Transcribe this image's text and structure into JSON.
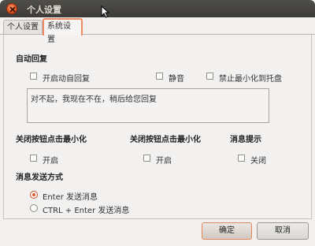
{
  "window": {
    "title": "个人设置"
  },
  "tabs": [
    {
      "label": "个人设置",
      "active": false
    },
    {
      "label": "系统设置",
      "active": true
    }
  ],
  "auto_reply": {
    "heading": "自动回复",
    "enable_label": "开启动自回复",
    "mute_label": "静音",
    "no_minimize_label": "禁止最小化到托盘",
    "reply_text": "对不起，我现在不在，稍后给您回复"
  },
  "close_minimize_1": {
    "heading": "关闭按钮点击最小化",
    "option_label": "开启"
  },
  "close_minimize_2": {
    "heading": "关闭按钮点击最小化",
    "option_label": "开启"
  },
  "notification": {
    "heading": "消息提示",
    "option_label": "关闭"
  },
  "send_method": {
    "heading": "消息发送方式",
    "options": [
      {
        "label": "Enter 发送消息",
        "selected": true
      },
      {
        "label": "CTRL + Enter 发送消息",
        "selected": false
      }
    ]
  },
  "buttons": {
    "ok": "确定",
    "cancel": "取消"
  },
  "colors": {
    "accent": "#e05a2a",
    "titlebar": "#3c3b37",
    "background": "#f2f1f0"
  }
}
